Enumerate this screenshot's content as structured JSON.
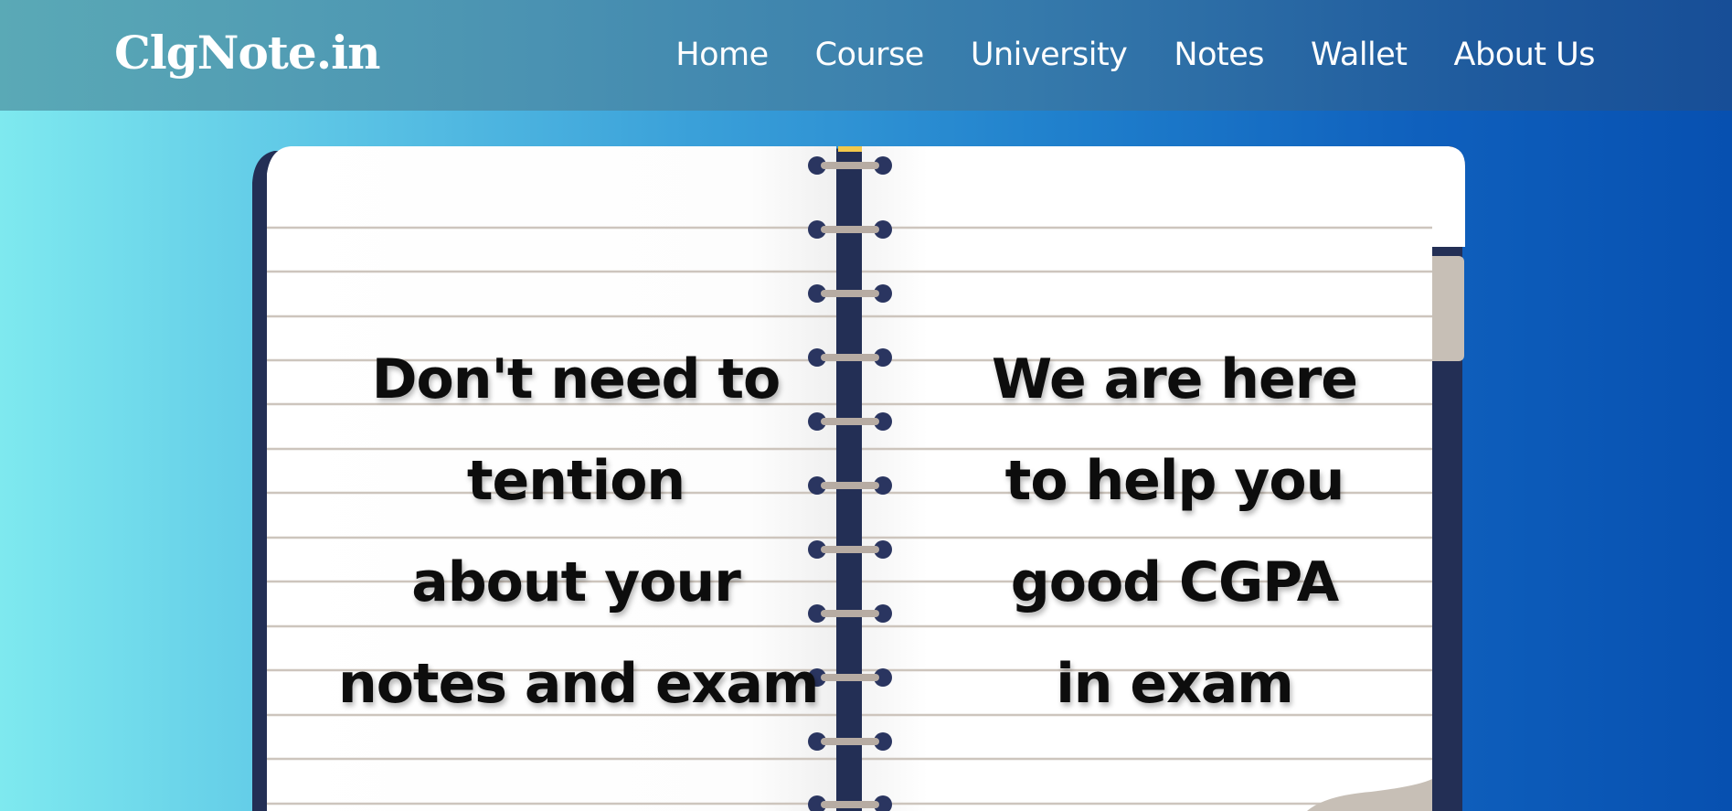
{
  "brand": "ClgNote.in",
  "nav": {
    "items": [
      {
        "label": "Home"
      },
      {
        "label": "Course"
      },
      {
        "label": "University"
      },
      {
        "label": "Notes"
      },
      {
        "label": "Wallet"
      },
      {
        "label": "About Us"
      }
    ]
  },
  "hero": {
    "left_page": {
      "lines": [
        "Don't need to",
        "tention",
        "about your",
        "notes and exam"
      ]
    },
    "right_page": {
      "lines": [
        "We are here",
        "to help you",
        "good CGPA",
        "in exam"
      ]
    }
  },
  "colors": {
    "navbar_start": "#5aa9b6",
    "navbar_end": "#174e97",
    "notebook_cover": "#232f55",
    "page": "#ffffff",
    "rule_line": "#cdc5bd",
    "spiral_ring": "#b7aca3",
    "text": "#0d0d0d"
  }
}
